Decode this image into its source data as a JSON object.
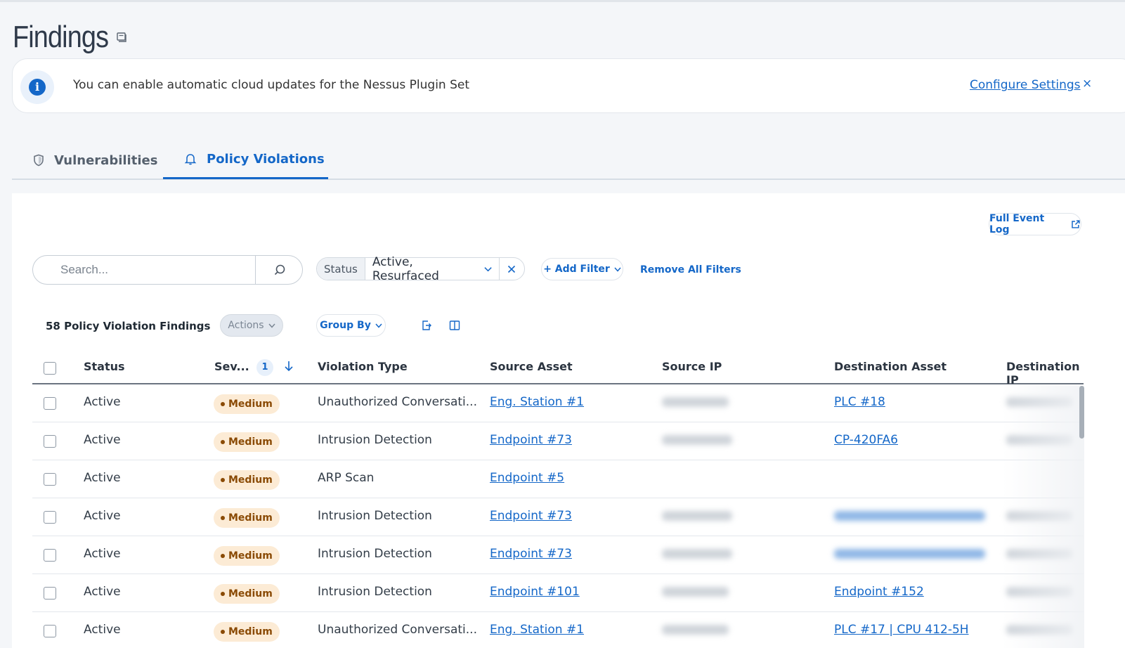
{
  "page": {
    "title": "Findings"
  },
  "banner": {
    "message": "You can enable automatic cloud updates for the Nessus Plugin Set",
    "link_label": "Configure Settings",
    "close_label": "×"
  },
  "tabs": [
    {
      "label": "Vulnerabilities",
      "icon": "shield-icon",
      "active": false
    },
    {
      "label": "Policy Violations",
      "icon": "bell-icon",
      "active": true
    }
  ],
  "toolbar": {
    "full_event_log": "Full Event Log",
    "search_placeholder": "Search...",
    "status_filter_key": "Status",
    "status_filter_value": "Active, Resurfaced",
    "add_filter": "+ Add Filter",
    "remove_all_filters": "Remove All Filters",
    "count_label": "58 Policy Violation Findings",
    "actions_label": "Actions",
    "group_by_label": "Group By"
  },
  "table": {
    "columns": {
      "status": "Status",
      "severity": "Sev...",
      "sort_count": "1",
      "violation_type": "Violation Type",
      "source_asset": "Source Asset",
      "source_ip": "Source IP",
      "destination_asset": "Destination Asset",
      "destination_ip": "Destination IP"
    },
    "rows": [
      {
        "status": "Active",
        "severity": "Medium",
        "violation_type": "Unauthorized Conversati...",
        "source_asset": "Eng. Station #1",
        "destination_asset": "PLC #18"
      },
      {
        "status": "Active",
        "severity": "Medium",
        "violation_type": "Intrusion Detection",
        "source_asset": "Endpoint #73",
        "destination_asset": "CP-420FA6"
      },
      {
        "status": "Active",
        "severity": "Medium",
        "violation_type": "ARP Scan",
        "source_asset": "Endpoint #5",
        "destination_asset": ""
      },
      {
        "status": "Active",
        "severity": "Medium",
        "violation_type": "Intrusion Detection",
        "source_asset": "Endpoint #73",
        "destination_asset": ""
      },
      {
        "status": "Active",
        "severity": "Medium",
        "violation_type": "Intrusion Detection",
        "source_asset": "Endpoint #73",
        "destination_asset": ""
      },
      {
        "status": "Active",
        "severity": "Medium",
        "violation_type": "Intrusion Detection",
        "source_asset": "Endpoint #101",
        "destination_asset": "Endpoint #152"
      },
      {
        "status": "Active",
        "severity": "Medium",
        "violation_type": "Unauthorized Conversati...",
        "source_asset": "Eng. Station #1",
        "destination_asset": "PLC #17 |  CPU 412-5H"
      }
    ]
  },
  "colors": {
    "accent": "#1467c8",
    "severity_medium_bg": "#fcebd5",
    "severity_medium_text": "#8a4a04"
  }
}
